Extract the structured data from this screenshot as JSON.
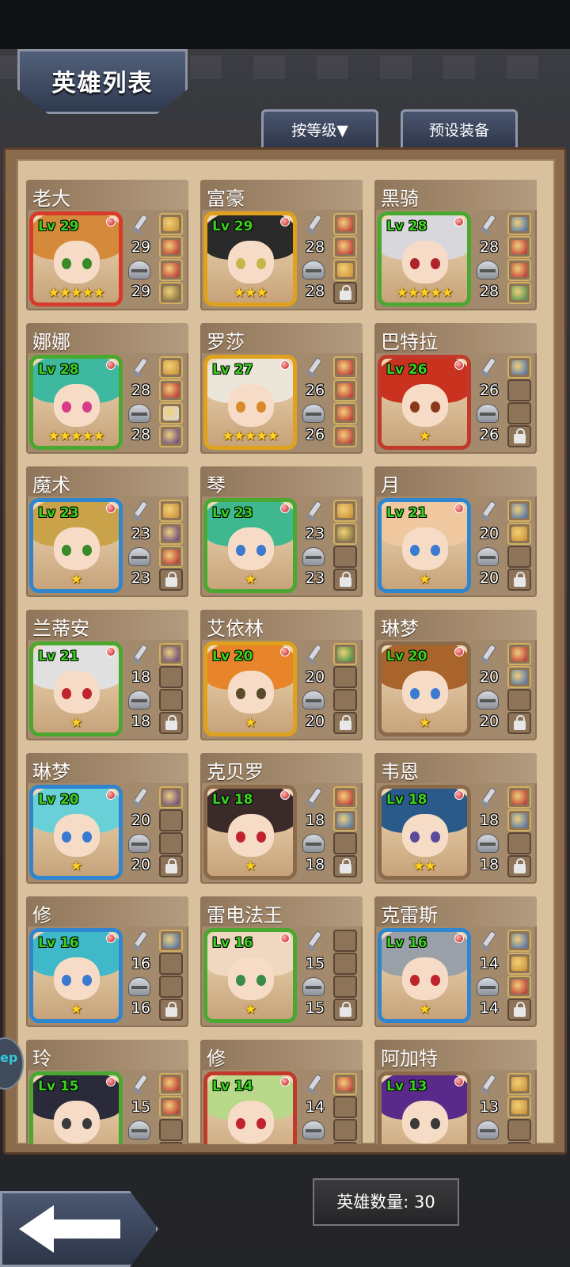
{
  "header": {
    "title": "英雄列表",
    "sort_label": "按等级▼",
    "preset_label": "预设装备"
  },
  "footer": {
    "hero_count_label": "英雄数量: 30"
  },
  "side_tab_text": "ep",
  "heroes": [
    {
      "name": "老大",
      "level": "Lv 29",
      "atk": "29",
      "def": "29",
      "stars": "★★★★★",
      "frame": "#d93b2b",
      "hair": "#d48a3a",
      "eye": "#3a8a2a",
      "slots": [
        "#c98a2d",
        "#b8232b",
        "#b8232b",
        "#7a6a3a"
      ]
    },
    {
      "name": "富豪",
      "level": "Lv 29",
      "atk": "28",
      "def": "28",
      "stars": "★★★",
      "frame": "#e0a21c",
      "hair": "#2a2a2a",
      "eye": "#c4b64a",
      "slots": [
        "#b8232b",
        "#b8232b",
        "#c98a2d",
        "lock"
      ]
    },
    {
      "name": "黑骑",
      "level": "Lv 28",
      "atk": "28",
      "def": "28",
      "stars": "★★★★★",
      "frame": "#4aa831",
      "hair": "#d8d8dc",
      "eye": "#b0232b",
      "slots": [
        "#3a6ab8",
        "#b8232b",
        "#b8232b",
        "#3a8a4a"
      ]
    },
    {
      "name": "娜娜",
      "level": "Lv 28",
      "atk": "28",
      "def": "28",
      "stars": "★★★★★",
      "frame": "#4aa831",
      "hair": "#3fb8a0",
      "eye": "#d83a8a",
      "slots": [
        "#c98a2d",
        "#b8232b",
        "#d8d8dc",
        "#5a3a8a"
      ]
    },
    {
      "name": "罗莎",
      "level": "Lv 27",
      "atk": "26",
      "def": "26",
      "stars": "★★★★★",
      "frame": "#e0a21c",
      "hair": "#ece6da",
      "eye": "#d88a2a",
      "slots": [
        "#b8232b",
        "#b8232b",
        "#b8232b",
        "#b8232b"
      ]
    },
    {
      "name": "巴特拉",
      "level": "Lv 26",
      "atk": "26",
      "def": "26",
      "stars": "★",
      "frame": "#c0392b",
      "hair": "#c8321e",
      "eye": "#8a3a1a",
      "slots": [
        "#3a6ab8",
        "",
        "",
        "lock"
      ]
    },
    {
      "name": "魔术",
      "level": "Lv 23",
      "atk": "23",
      "def": "23",
      "stars": "★",
      "frame": "#2f86d0",
      "hair": "#c9a24a",
      "eye": "#3a8a2a",
      "slots": [
        "#c98a2d",
        "#5a3a8a",
        "#b8232b",
        "lock"
      ]
    },
    {
      "name": "琴",
      "level": "Lv 23",
      "atk": "23",
      "def": "23",
      "stars": "★",
      "frame": "#4aa831",
      "hair": "#3fb890",
      "eye": "#3a7ad0",
      "slots": [
        "#c98a2d",
        "#7a6a3a",
        "",
        "lock"
      ]
    },
    {
      "name": "月",
      "level": "Lv 21",
      "atk": "20",
      "def": "20",
      "stars": "★",
      "frame": "#2f86d0",
      "hair": "#f0c8a0",
      "eye": "#3a7ad0",
      "slots": [
        "#3a6ab8",
        "#c98a2d",
        "",
        "lock"
      ]
    },
    {
      "name": "兰蒂安",
      "level": "Lv 21",
      "atk": "18",
      "def": "18",
      "stars": "★",
      "frame": "#4aa831",
      "hair": "#e0e0e0",
      "eye": "#c0232b",
      "slots": [
        "#5a3a8a",
        "",
        "",
        "lock"
      ]
    },
    {
      "name": "艾依林",
      "level": "Lv 20",
      "atk": "20",
      "def": "20",
      "stars": "★",
      "frame": "#e0a21c",
      "hair": "#e8842a",
      "eye": "#5a4a2a",
      "slots": [
        "#2a8a3a",
        "",
        "",
        "lock"
      ]
    },
    {
      "name": "琳梦",
      "level": "Lv 20",
      "atk": "20",
      "def": "20",
      "stars": "★",
      "frame": "#8a6a4a",
      "hair": "#a8642a",
      "eye": "#3a7ad0",
      "slots": [
        "#b8232b",
        "#3a6ab8",
        "",
        "lock"
      ]
    },
    {
      "name": "琳梦",
      "level": "Lv 20",
      "atk": "20",
      "def": "20",
      "stars": "★",
      "frame": "#2f86d0",
      "hair": "#6ad0d8",
      "eye": "#3a7ad0",
      "slots": [
        "#5a3a8a",
        "",
        "",
        "lock"
      ]
    },
    {
      "name": "克贝罗",
      "level": "Lv 18",
      "atk": "18",
      "def": "18",
      "stars": "★",
      "frame": "#8a6a4a",
      "hair": "#3a2a2a",
      "eye": "#c0232b",
      "slots": [
        "#b8232b",
        "#3a6ab8",
        "",
        "lock"
      ]
    },
    {
      "name": "韦恩",
      "level": "Lv 18",
      "atk": "18",
      "def": "18",
      "stars": "★★",
      "frame": "#8a6a4a",
      "hair": "#2a5a8a",
      "eye": "#5a4a9a",
      "slots": [
        "#b8232b",
        "#3a6ab8",
        "",
        "lock"
      ]
    },
    {
      "name": "修",
      "level": "Lv 16",
      "atk": "16",
      "def": "16",
      "stars": "★",
      "frame": "#2f86d0",
      "hair": "#3fb8c8",
      "eye": "#3a7ad0",
      "slots": [
        "#3a6ab8",
        "",
        "",
        "lock"
      ]
    },
    {
      "name": "雷电法王",
      "level": "Lv 16",
      "atk": "15",
      "def": "15",
      "stars": "★",
      "frame": "#4aa831",
      "hair": "#f0d8c0",
      "eye": "#3a8a4a",
      "slots": [
        "",
        "",
        "",
        "lock"
      ]
    },
    {
      "name": "克雷斯",
      "level": "Lv 16",
      "atk": "14",
      "def": "14",
      "stars": "★",
      "frame": "#2f86d0",
      "hair": "#9aa0a8",
      "eye": "#c0232b",
      "slots": [
        "#3a6ab8",
        "#c98a2d",
        "#b8232b",
        "lock"
      ]
    },
    {
      "name": "玲",
      "level": "Lv 15",
      "atk": "15",
      "def": "",
      "stars": "",
      "frame": "#4aa831",
      "hair": "#2a2a3a",
      "eye": "#3a3a3a",
      "slots": [
        "#b8232b",
        "#b8232b",
        "",
        ""
      ]
    },
    {
      "name": "修",
      "level": "Lv 14",
      "atk": "14",
      "def": "",
      "stars": "",
      "frame": "#c0392b",
      "hair": "#b8d88a",
      "eye": "#c0232b",
      "slots": [
        "#b8232b",
        "",
        "",
        ""
      ]
    },
    {
      "name": "阿加特",
      "level": "Lv 13",
      "atk": "13",
      "def": "",
      "stars": "",
      "frame": "#8a6a4a",
      "hair": "#5a2a8a",
      "eye": "#3a3a3a",
      "slots": [
        "#c98a2d",
        "#c98a2d",
        "",
        ""
      ]
    }
  ]
}
